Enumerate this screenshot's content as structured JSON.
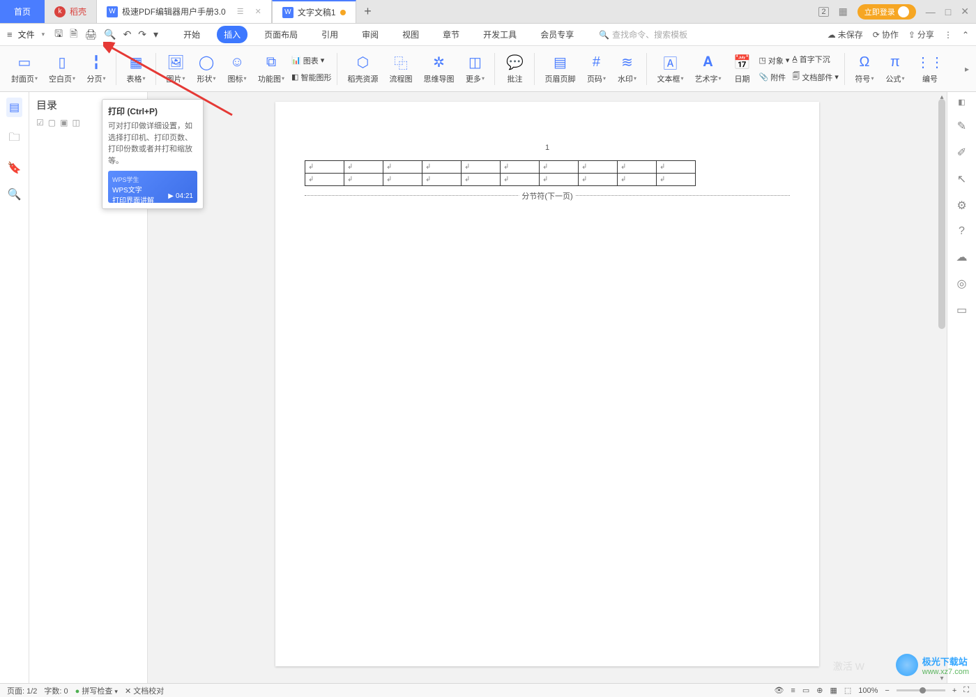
{
  "tabs": {
    "home": "首页",
    "shell": "稻壳",
    "doc1": "极速PDF编辑器用户手册3.0",
    "doc2": "文字文稿1",
    "plus": "+"
  },
  "window": {
    "login": "立即登录",
    "badge": "2"
  },
  "qa": {
    "file": "文件"
  },
  "menu": {
    "items": [
      "开始",
      "插入",
      "页面布局",
      "引用",
      "审阅",
      "视图",
      "章节",
      "开发工具",
      "会员专享"
    ],
    "active_index": 1,
    "search": "查找命令、搜索模板",
    "right": {
      "unsaved": "未保存",
      "coop": "协作",
      "share": "分享"
    }
  },
  "ribbon": {
    "g": [
      "封面页",
      "空白页",
      "分页",
      "表格",
      "图片",
      "形状",
      "图标",
      "功能图",
      "稻壳资源",
      "流程图",
      "思维导图",
      "更多",
      "批注",
      "页眉页脚",
      "页码",
      "水印",
      "文本框",
      "艺术字",
      "日期",
      "符号",
      "公式",
      "编号"
    ],
    "links": {
      "chart": "图表",
      "smart": "智能图形",
      "obj": "对象",
      "att": "附件",
      "drop": "首字下沉",
      "docpart": "文档部件"
    }
  },
  "nav": {
    "title": "目录"
  },
  "page": {
    "num": "1",
    "cell": "↲",
    "section": "分节符(下一页)"
  },
  "tooltip": {
    "title": "打印 (Ctrl+P)",
    "desc": "可对打印做详细设置，如选择打印机、打印页数、打印份数或者并打和缩放等。",
    "video_tag": "WPS学生",
    "video_line1": "WPS文字",
    "video_line2": "打印界面讲解",
    "duration": "04:21"
  },
  "status": {
    "page": "页面: 1/2",
    "words": "字数: 0",
    "spell": "拼写检查",
    "proof": "文档校对",
    "zoom": "100%"
  },
  "watermark": {
    "name": "极光下载站",
    "url": "www.xz7.com",
    "activate": "激活 W"
  }
}
